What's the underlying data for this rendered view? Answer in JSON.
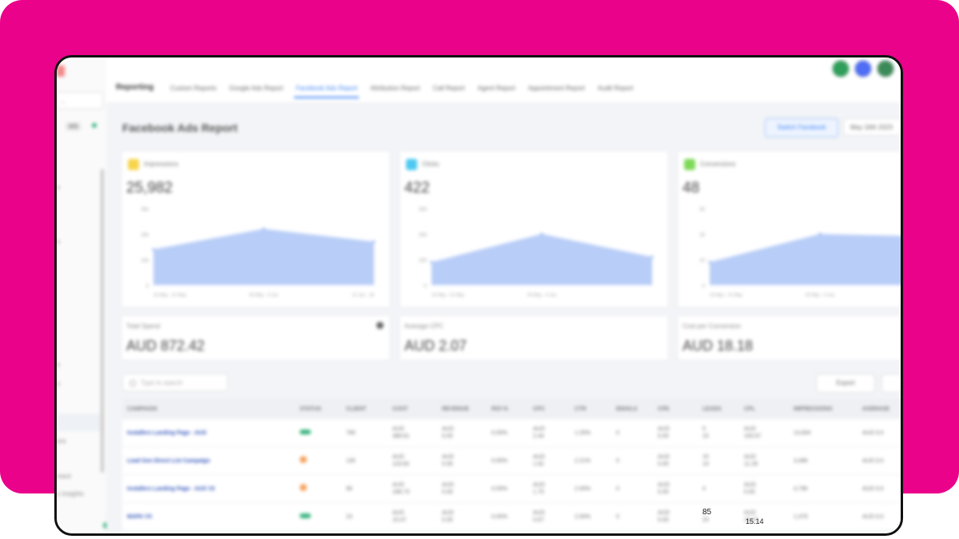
{
  "sidebar": {
    "account_select": "...",
    "badge": "365",
    "items": [
      "s",
      "s",
      "s",
      "s",
      "s",
      "ere",
      "ment",
      "s Insights"
    ]
  },
  "nav": {
    "section_title": "Reporting",
    "tabs": [
      "Custom Reports",
      "Google Ads Report",
      "Facebook Ads Report",
      "Attribution Report",
      "Call Report",
      "Agent Report",
      "Appointment Report",
      "Audit Report"
    ],
    "active_tab": "Facebook Ads Report"
  },
  "page": {
    "title": "Facebook Ads Report",
    "connect_button": "Switch Facebook",
    "date_range": "May 16th 2023"
  },
  "kpis": [
    {
      "label": "Impressions",
      "value": "25,982",
      "icon_color": "#f7d44c",
      "yticks": [
        "30k",
        "20k",
        "10k",
        "0"
      ],
      "xticks": [
        "15 May - 21 May",
        "29 May - 4 Jun",
        "12 Jun - 18"
      ],
      "points": [
        14,
        22,
        17
      ]
    },
    {
      "label": "Clicks",
      "value": "422",
      "icon_color": "#4cc9f0",
      "yticks": [
        "300",
        "200",
        "100",
        "0"
      ],
      "xticks": [
        "15 May - 21 May",
        "29 May - 4 Jun",
        ""
      ],
      "points": [
        90,
        200,
        110
      ]
    },
    {
      "label": "Conversions",
      "value": "48",
      "icon_color": "#7ed957",
      "yticks": [
        "30",
        "20",
        "10",
        "0"
      ],
      "xticks": [
        "15 May - 21 May",
        "29 May - 4 Jun",
        ""
      ],
      "points": [
        9,
        20,
        19
      ]
    }
  ],
  "stats": [
    {
      "label": "Total Spend",
      "value": "AUD 872.42"
    },
    {
      "label": "Average CPC",
      "value": "AUD 2.07"
    },
    {
      "label": "Cost per Conversion",
      "value": "AUD 18.18"
    }
  ],
  "table": {
    "search_placeholder": "Type to search",
    "export_label": "Export",
    "columns": [
      "CAMPAIGN",
      "STATUS",
      "CLIENT",
      "COST",
      "REVENUE",
      "ROI %",
      "CPC",
      "CTR",
      "EMAILS",
      "CPE",
      "LEADS",
      "CPL",
      "IMPRESSIONS",
      "AVERAGE"
    ],
    "rows": [
      {
        "campaign": "Installers Landing Page - AUS",
        "status": "active",
        "client": "790",
        "cost": "AUD\n389.61",
        "revenue": "AUD\n0.00",
        "roi": "0.00%",
        "cpc": "AUD\n2.44",
        "ctr": "1.20%",
        "emails": "0",
        "cpe": "AUD\n0.00",
        "leads": "5\n10",
        "cpl": "AUD\n100.67",
        "impressions": "14,604",
        "average": "AUD 0.0"
      },
      {
        "campaign": "Lead Gen Direct List Campaign",
        "status": "warn",
        "client": "135",
        "cost": "AUD\n119.83",
        "revenue": "AUD\n0.00",
        "roi": "0.00%",
        "cpc": "AUD\n1.62",
        "ctr": "2.21%",
        "emails": "0",
        "cpe": "AUD\n0.00",
        "leads": "15\n14",
        "cpl": "AUD\n11.28",
        "impressions": "3,496",
        "average": "AUD 0.0"
      },
      {
        "campaign": "Installers Landing Page - AUS V2",
        "status": "warn",
        "client": "96",
        "cost": "AUD\n168.73",
        "revenue": "AUD\n0.00",
        "roi": "0.00%",
        "cpc": "AUD\n1.75",
        "ctr": "2.00%",
        "emails": "0",
        "cpe": "AUD\n0.00",
        "leads": "4",
        "cpl": "AUD\n0.00",
        "impressions": "4,796",
        "average": "AUD 0.0"
      },
      {
        "campaign": "MAPA VS",
        "status": "active",
        "client": "23",
        "cost": "AUD\n15.47",
        "revenue": "AUD\n0.00",
        "roi": "0.00%",
        "cpc": "AUD\n0.67",
        "ctr": "2.00%",
        "emails": "0",
        "cpe": "AUD\n0.00",
        "leads": "1\n20",
        "cpl": "AUD\n15.47",
        "impressions": "1,479",
        "average": "AUD 0.0"
      }
    ]
  },
  "overlay": {
    "left": "85",
    "right": "15.14"
  },
  "colors": {
    "brand_pink": "#ea028b",
    "accent_blue": "#3b82f6",
    "chart_fill": "#b8cdf7",
    "status_green": "#36b37e",
    "status_orange": "#f5a25d"
  }
}
